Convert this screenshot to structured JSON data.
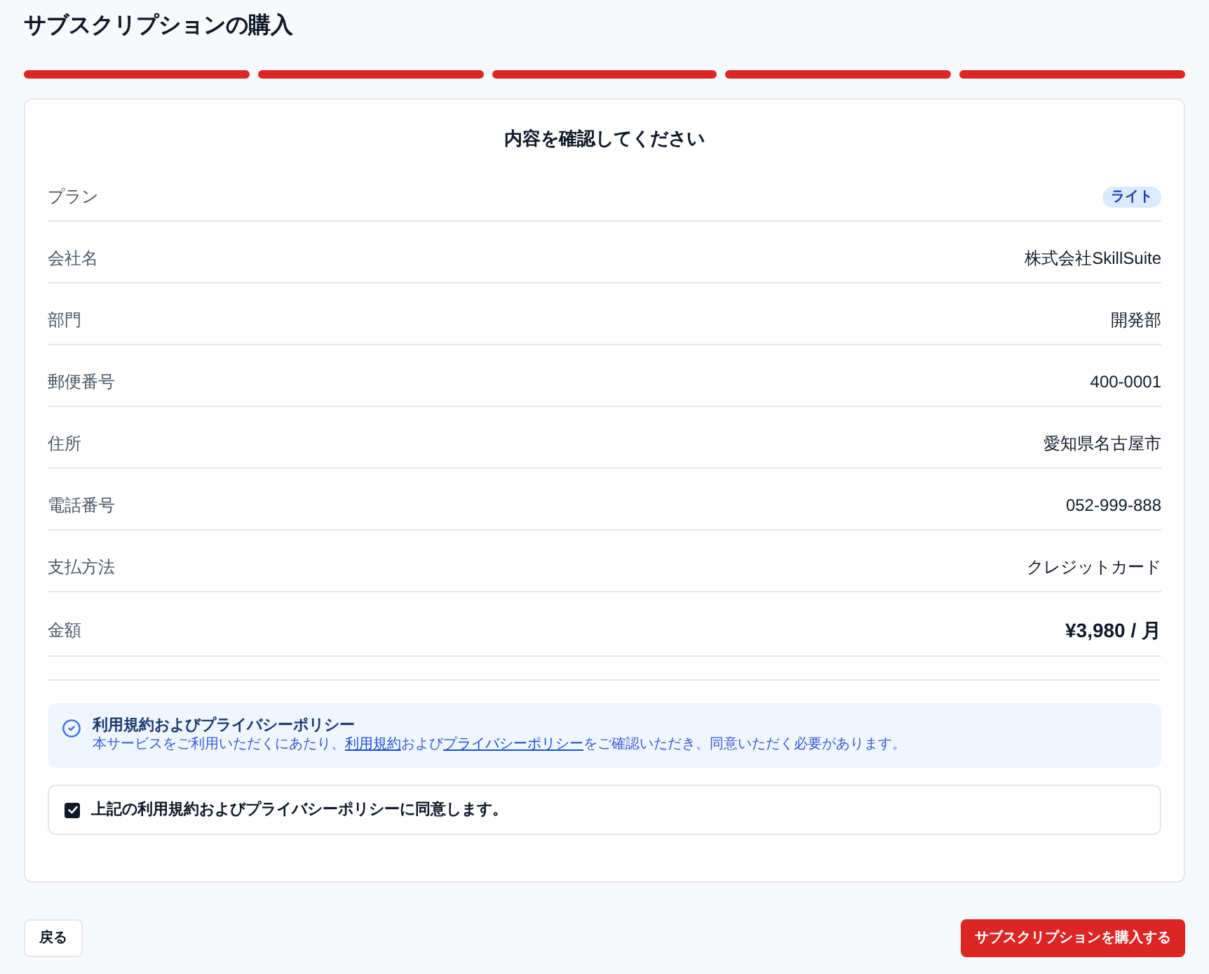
{
  "page": {
    "title": "サブスクリプションの購入"
  },
  "progress_steps": [
    {
      "completed": true
    },
    {
      "completed": true
    },
    {
      "completed": true
    },
    {
      "completed": true
    },
    {
      "completed": true
    }
  ],
  "card": {
    "heading": "内容を確認してください",
    "rows": [
      {
        "kind": "badge",
        "label": "プラン",
        "value": "ライト"
      },
      {
        "kind": "text",
        "label": "会社名",
        "value": "株式会社SkillSuite"
      },
      {
        "kind": "text",
        "label": "部門",
        "value": "開発部"
      },
      {
        "kind": "text",
        "label": "郵便番号",
        "value": "400-0001"
      },
      {
        "kind": "text",
        "label": "住所",
        "value": "愛知県名古屋市"
      },
      {
        "kind": "text",
        "label": "電話番号",
        "value": "052-999-888"
      },
      {
        "kind": "text",
        "label": "支払方法",
        "value": "クレジットカード"
      },
      {
        "kind": "total",
        "label": "金額",
        "value": "¥3,980 / 月"
      }
    ],
    "notice": {
      "title": "利用規約およびプライバシーポリシー",
      "description": [
        {
          "kind": "text",
          "text": "本サービスをご利用いただくにあたり、"
        },
        {
          "kind": "link",
          "text": "利用規約"
        },
        {
          "kind": "text",
          "text": "および"
        },
        {
          "kind": "link",
          "text": "プライバシーポリシー"
        },
        {
          "kind": "text",
          "text": "をご確認いただき、同意いただく必要があります。"
        }
      ]
    },
    "agreement": {
      "label": "上記の利用規約およびプライバシーポリシーに同意します。",
      "checked": true
    }
  },
  "buttons": [
    {
      "kind": "secondary",
      "label": "戻る"
    },
    {
      "kind": "primary",
      "label": "サブスクリプションを購入する"
    }
  ]
}
